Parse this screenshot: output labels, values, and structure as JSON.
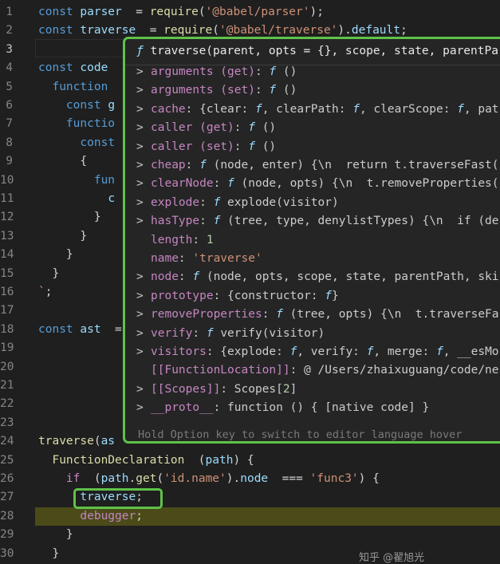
{
  "editor": {
    "lines": [
      {
        "n": "1",
        "t": [
          [
            "kw",
            "const "
          ],
          [
            "var",
            "parser"
          ],
          [
            "",
            "  = "
          ],
          [
            "fn",
            "require"
          ],
          [
            "",
            "("
          ],
          [
            "str",
            "'@babel/parser'"
          ],
          [
            "",
            ");"
          ]
        ]
      },
      {
        "n": "2",
        "t": [
          [
            "kw",
            "const "
          ],
          [
            "var",
            "traverse"
          ],
          [
            "",
            "  = "
          ],
          [
            "fn",
            "require"
          ],
          [
            "",
            "("
          ],
          [
            "str",
            "'@babel/traverse'"
          ],
          [
            "",
            ")."
          ],
          [
            "var",
            "default"
          ],
          [
            "",
            ";"
          ]
        ]
      },
      {
        "n": "3",
        "t": []
      },
      {
        "n": "4",
        "t": [
          [
            "kw",
            "const "
          ],
          [
            "var",
            "code"
          ]
        ]
      },
      {
        "n": "5",
        "t": [
          [
            "",
            "  "
          ],
          [
            "kw",
            "function"
          ]
        ]
      },
      {
        "n": "6",
        "t": [
          [
            "",
            "    "
          ],
          [
            "kw",
            "const "
          ],
          [
            "var",
            "g"
          ]
        ]
      },
      {
        "n": "7",
        "t": [
          [
            "",
            "    "
          ],
          [
            "kw",
            "functio"
          ]
        ]
      },
      {
        "n": "8",
        "t": [
          [
            "",
            "      "
          ],
          [
            "kw",
            "const"
          ]
        ]
      },
      {
        "n": "9",
        "t": [
          [
            "",
            "      {"
          ]
        ]
      },
      {
        "n": "10",
        "t": [
          [
            "",
            "        "
          ],
          [
            "kw",
            "fun"
          ]
        ]
      },
      {
        "n": "11",
        "t": [
          [
            "",
            "          "
          ],
          [
            "var",
            "c"
          ]
        ]
      },
      {
        "n": "12",
        "t": [
          [
            "",
            "        }"
          ]
        ]
      },
      {
        "n": "13",
        "t": [
          [
            "",
            "      }"
          ]
        ]
      },
      {
        "n": "14",
        "t": [
          [
            "",
            "    }"
          ]
        ]
      },
      {
        "n": "15",
        "t": [
          [
            "",
            "  }"
          ]
        ]
      },
      {
        "n": "16",
        "t": [
          [
            "str",
            "`"
          ],
          [
            "",
            ";"
          ]
        ]
      },
      {
        "n": "17",
        "t": []
      },
      {
        "n": "18",
        "t": [
          [
            "kw",
            "const "
          ],
          [
            "var",
            "ast"
          ],
          [
            "",
            "  ="
          ]
        ]
      },
      {
        "n": "19",
        "t": []
      },
      {
        "n": "20",
        "t": []
      },
      {
        "n": "21",
        "t": []
      },
      {
        "n": "22",
        "t": []
      },
      {
        "n": "23",
        "t": []
      },
      {
        "n": "24",
        "t": [
          [
            "fn",
            "traverse"
          ],
          [
            "",
            "("
          ],
          [
            "var",
            "as"
          ]
        ]
      },
      {
        "n": "25",
        "t": [
          [
            "",
            "  "
          ],
          [
            "fn",
            "FunctionDeclaration"
          ],
          [
            "",
            "  ("
          ],
          [
            "var",
            "path"
          ],
          [
            "",
            ") {"
          ]
        ]
      },
      {
        "n": "26",
        "t": [
          [
            "",
            "    "
          ],
          [
            "ctl",
            "if"
          ],
          [
            "",
            "  ("
          ],
          [
            "var",
            "path"
          ],
          [
            "",
            "."
          ],
          [
            "fn",
            "get"
          ],
          [
            "",
            "("
          ],
          [
            "str",
            "'id.name'"
          ],
          [
            "",
            ")."
          ],
          [
            "var",
            "node"
          ],
          [
            "",
            "  === "
          ],
          [
            "str",
            "'func3'"
          ],
          [
            "",
            ") {"
          ]
        ]
      },
      {
        "n": "27",
        "t": [
          [
            "",
            "      "
          ],
          [
            "var",
            "traverse"
          ],
          [
            "",
            ";"
          ]
        ]
      },
      {
        "n": "28",
        "t": [
          [
            "",
            "      "
          ],
          [
            "ctl",
            "debugger"
          ],
          [
            "",
            ";"
          ]
        ]
      },
      {
        "n": "29",
        "t": [
          [
            "",
            "    }"
          ]
        ]
      },
      {
        "n": "30",
        "t": [
          [
            "",
            "  }"
          ]
        ]
      }
    ]
  },
  "hover": {
    "signature": "traverse(parent, opts = {}, scope, state, parentPa",
    "rows": [
      {
        "chev": ">",
        "name": "arguments (get)",
        "val": " f ()"
      },
      {
        "chev": ">",
        "name": "arguments (set)",
        "val": " f ()"
      },
      {
        "chev": ">",
        "name": "cache",
        "val": " {clear: f, clearPath: f, clearScope: f, pat"
      },
      {
        "chev": ">",
        "name": "caller (get)",
        "val": " f ()"
      },
      {
        "chev": ">",
        "name": "caller (set)",
        "val": " f ()"
      },
      {
        "chev": ">",
        "name": "cheap",
        "val": " f (node, enter) {\\n  return t.traverseFast("
      },
      {
        "chev": ">",
        "name": "clearNode",
        "val": " f (node, opts) {\\n  t.removeProperties("
      },
      {
        "chev": ">",
        "name": "explode",
        "val": " f explode(visitor)"
      },
      {
        "chev": ">",
        "name": "hasType",
        "val": " f (tree, type, denylistTypes) {\\n  if (de"
      },
      {
        "chev": "",
        "name": "length",
        "val": " 1"
      },
      {
        "chev": "",
        "name": "name",
        "val": " 'traverse'"
      },
      {
        "chev": ">",
        "name": "node",
        "val": " f (node, opts, scope, state, parentPath, ski"
      },
      {
        "chev": ">",
        "name": "prototype",
        "val": " {constructor: f}"
      },
      {
        "chev": ">",
        "name": "removeProperties",
        "val": " f (tree, opts) {\\n  t.traverseFa"
      },
      {
        "chev": ">",
        "name": "verify",
        "val": " f verify(visitor)"
      },
      {
        "chev": ">",
        "name": "visitors",
        "val": " {explode: f, verify: f, merge: f, __esMo"
      },
      {
        "chev": "",
        "name": "[[FunctionLocation]]",
        "val": " @ /Users/zhaixuguang/code/ne"
      },
      {
        "chev": ">",
        "name": "[[Scopes]]",
        "val": " Scopes[2]"
      },
      {
        "chev": ">",
        "name": "__proto__",
        "val": " function () { [native code] }"
      }
    ],
    "hint": "Hold Option key to switch to editor language hover"
  },
  "watermark": "知乎 @翟旭光"
}
